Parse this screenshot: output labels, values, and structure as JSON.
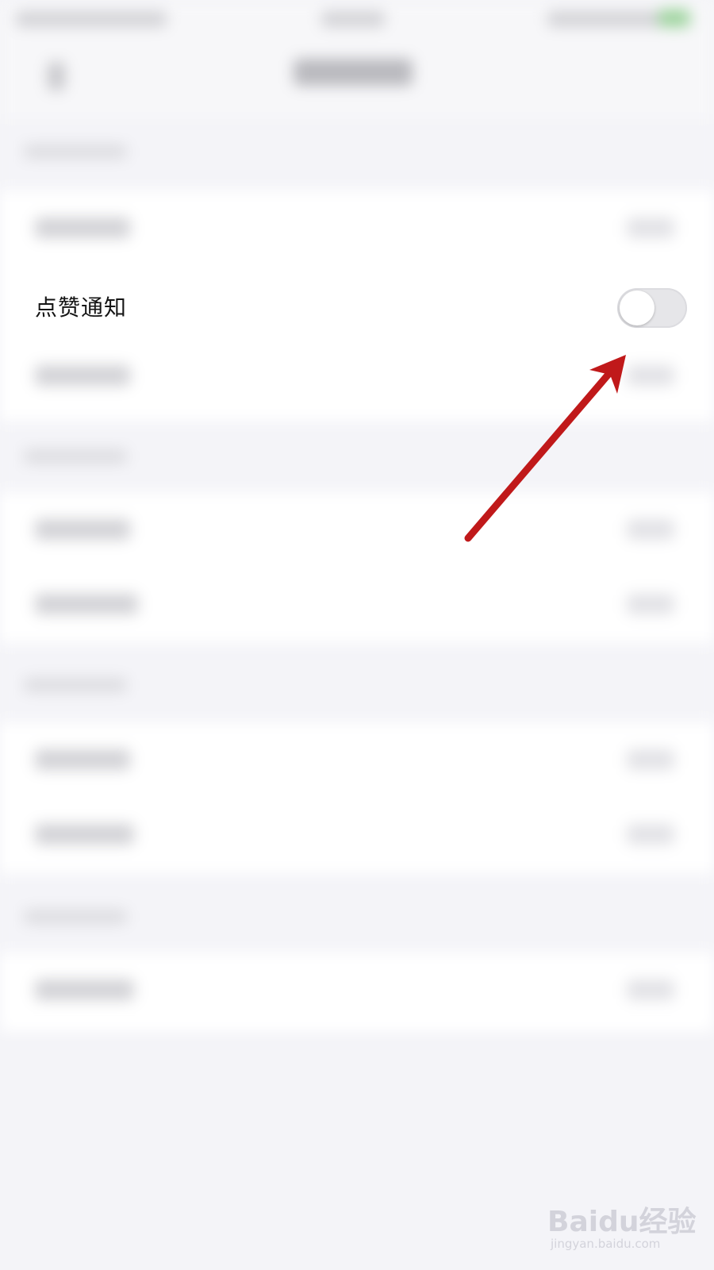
{
  "screen": {
    "background": "#f4f4f8"
  },
  "setting_row": {
    "label": "点赞通知",
    "toggle": {
      "on": false,
      "track_color": "#e6e6e9",
      "knob_color": "#ffffff"
    }
  },
  "annotation": {
    "arrow_color": "#c0191a",
    "target": "toggle"
  },
  "watermark": {
    "logo": "Baidu经验",
    "url": "jingyan.baidu.com"
  }
}
